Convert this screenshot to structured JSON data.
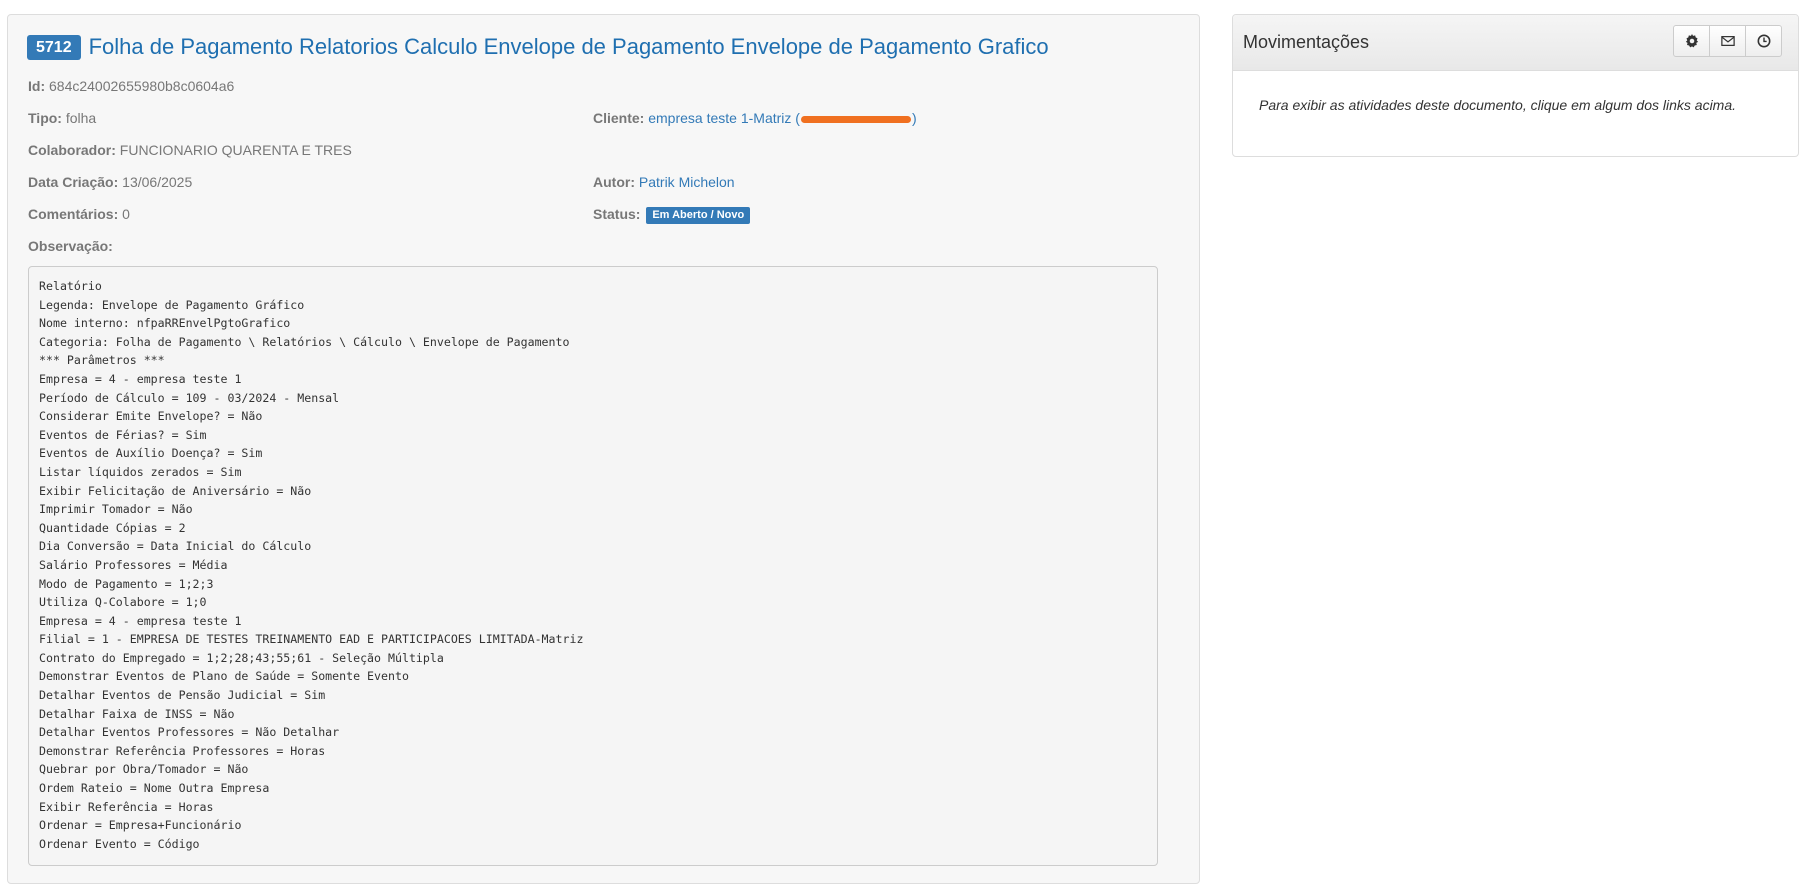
{
  "document": {
    "number": "5712",
    "title": "Folha de Pagamento Relatorios Calculo Envelope de Pagamento Envelope de Pagamento Grafico",
    "id_label": "Id:",
    "id_value": "684c24002655980b8c0604a6",
    "tipo_label": "Tipo:",
    "tipo_value": "folha",
    "cliente_label": "Cliente:",
    "cliente_value": "empresa teste 1-Matriz",
    "cliente_open_paren": "(",
    "cliente_close_paren": ")",
    "colaborador_label": "Colaborador:",
    "colaborador_value": "FUNCIONARIO QUARENTA E TRES",
    "data_criacao_label": "Data Criação:",
    "data_criacao_value": "13/06/2025",
    "autor_label": "Autor:",
    "autor_value": "Patrik Michelon",
    "comentarios_label": "Comentários:",
    "comentarios_value": "0",
    "status_label": "Status:",
    "status_value": "Em Aberto / Novo",
    "status_color": "#337ab7",
    "observacao_label": "Observação:",
    "observacao_lines": [
      "Relatório",
      "Legenda: Envelope de Pagamento Gráfico",
      "Nome interno: nfpaRREnvelPgtoGrafico",
      "Categoria: Folha de Pagamento \\ Relatórios \\ Cálculo \\ Envelope de Pagamento",
      "*** Parâmetros ***",
      "Empresa = 4 - empresa teste 1",
      "Período de Cálculo = 109 - 03/2024 - Mensal",
      "Considerar Emite Envelope? = Não",
      "Eventos de Férias? = Sim",
      "Eventos de Auxílio Doença? = Sim",
      "Listar líquidos zerados = Sim",
      "Exibir Felicitação de Aniversário = Não",
      "Imprimir Tomador = Não",
      "Quantidade Cópias = 2",
      "Dia Conversão = Data Inicial do Cálculo",
      "Salário Professores = Média",
      "Modo de Pagamento = 1;2;3",
      "Utiliza Q-Colabore = 1;0",
      "Empresa = 4 - empresa teste 1",
      "Filial = 1 - EMPRESA DE TESTES TREINAMENTO EAD E PARTICIPACOES LIMITADA-Matriz",
      "Contrato do Empregado = 1;2;28;43;55;61 - Seleção Múltipla",
      "Demonstrar Eventos de Plano de Saúde = Somente Evento",
      "Detalhar Eventos de Pensão Judicial = Sim",
      "Detalhar Faixa de INSS = Não",
      "Detalhar Eventos Professores = Não Detalhar",
      "Demonstrar Referência Professores = Horas",
      "Quebrar por Obra/Tomador = Não",
      "Ordem Rateio = Nome Outra Empresa",
      "Exibir Referência = Horas",
      "Ordenar = Empresa+Funcionário",
      "Ordenar Evento = Código"
    ]
  },
  "movimentacoes": {
    "title": "Movimentações",
    "buttons": [
      {
        "icon": "gear-icon"
      },
      {
        "icon": "envelope-icon"
      },
      {
        "icon": "clock-icon"
      }
    ],
    "hint": "Para exibir as atividades deste documento, clique em algum dos links acima."
  },
  "colors": {
    "link": "#337ab7",
    "badge": "#337ab7",
    "redaction": "#f07020"
  }
}
